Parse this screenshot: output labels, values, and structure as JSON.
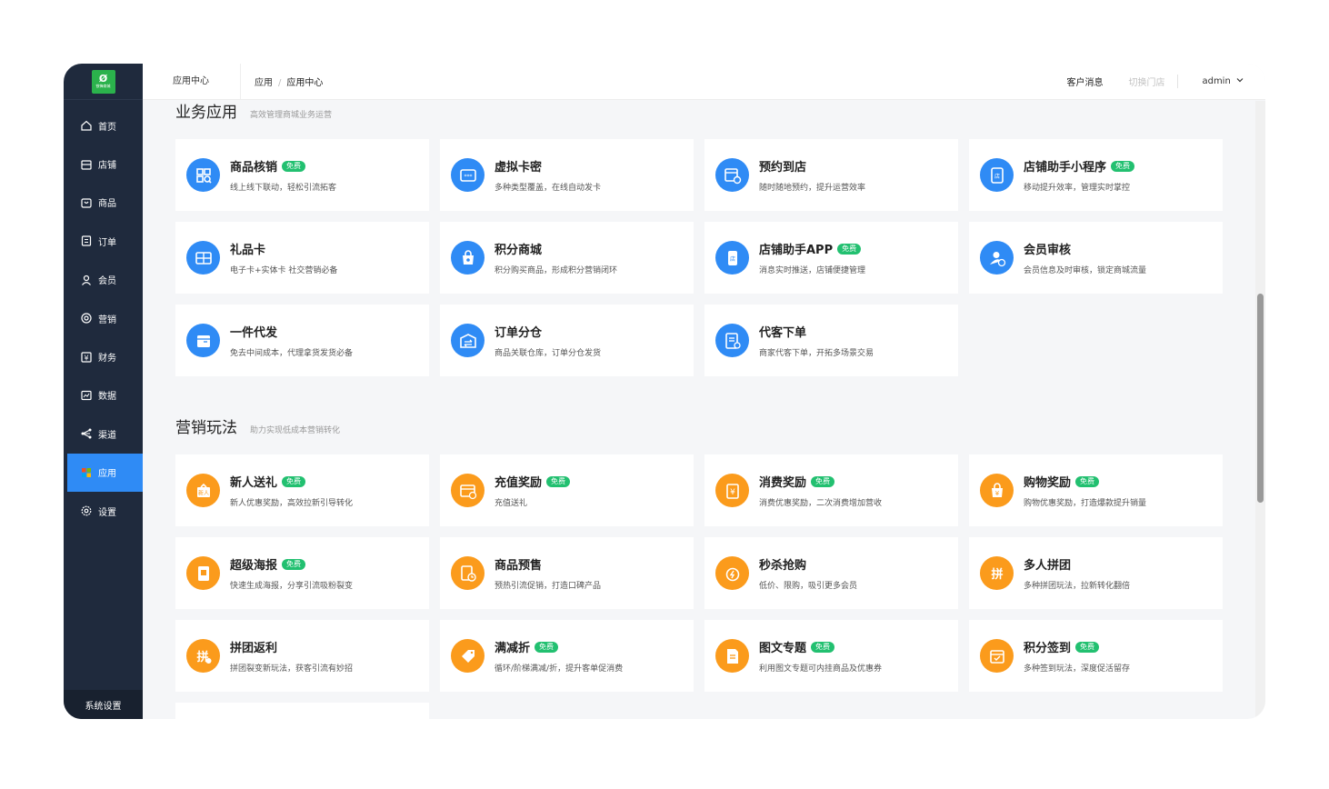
{
  "logo": {
    "glyph": "Ø",
    "text": "铁锋商城"
  },
  "sidebar": {
    "items": [
      {
        "label": "首页",
        "icon": "home-icon"
      },
      {
        "label": "店铺",
        "icon": "store-icon"
      },
      {
        "label": "商品",
        "icon": "goods-icon"
      },
      {
        "label": "订单",
        "icon": "order-icon"
      },
      {
        "label": "会员",
        "icon": "member-icon"
      },
      {
        "label": "营销",
        "icon": "marketing-icon"
      },
      {
        "label": "财务",
        "icon": "finance-icon"
      },
      {
        "label": "数据",
        "icon": "data-icon"
      },
      {
        "label": "渠道",
        "icon": "channel-icon"
      },
      {
        "label": "应用",
        "icon": "apps-icon",
        "active": true
      },
      {
        "label": "设置",
        "icon": "settings-icon"
      }
    ],
    "system_settings": "系统设置"
  },
  "header": {
    "title": "应用中心",
    "breadcrumb": [
      "应用",
      "应用中心"
    ],
    "messages": "客户消息",
    "switch_store": "切换门店",
    "user": "admin"
  },
  "sections": [
    {
      "title": "业务应用",
      "subtitle": "高效管理商城业务运营",
      "color": "blue",
      "cards": [
        {
          "name": "商品核销",
          "free": true,
          "desc": "线上线下联动，轻松引流拓客",
          "icon": "qr-scan-icon"
        },
        {
          "name": "虚拟卡密",
          "free": false,
          "desc": "多种类型覆盖，在线自动发卡",
          "icon": "virtual-card-icon"
        },
        {
          "name": "预约到店",
          "free": false,
          "desc": "随时随地预约，提升运营效率",
          "icon": "calendar-clock-icon"
        },
        {
          "name": "店铺助手小程序",
          "free": true,
          "desc": "移动提升效率，管理实时掌控",
          "icon": "mini-program-icon"
        },
        {
          "name": "礼品卡",
          "free": false,
          "desc": "电子卡+实体卡 社交营销必备",
          "icon": "gift-card-icon"
        },
        {
          "name": "积分商城",
          "free": false,
          "desc": "积分购买商品，形成积分营销闭环",
          "icon": "points-bag-icon"
        },
        {
          "name": "店铺助手APP",
          "free": true,
          "desc": "消息实时推送，店铺便捷管理",
          "icon": "phone-app-icon"
        },
        {
          "name": "会员审核",
          "free": false,
          "desc": "会员信息及时审核，锁定商城流量",
          "icon": "member-check-icon"
        },
        {
          "name": "一件代发",
          "free": false,
          "desc": "免去中间成本，代理拿货发货必备",
          "icon": "dropship-box-icon"
        },
        {
          "name": "订单分仓",
          "free": false,
          "desc": "商品关联仓库，订单分仓发货",
          "icon": "warehouse-icon"
        },
        {
          "name": "代客下单",
          "free": false,
          "desc": "商家代客下单，开拓多场景交易",
          "icon": "order-list-icon"
        }
      ]
    },
    {
      "title": "营销玩法",
      "subtitle": "助力实现低成本营销转化",
      "color": "orange",
      "cards": [
        {
          "name": "新人送礼",
          "free": true,
          "desc": "新人优惠奖励，高效拉新引导转化",
          "icon": "new-gift-icon"
        },
        {
          "name": "充值奖励",
          "free": true,
          "desc": "充值送礼",
          "icon": "recharge-icon"
        },
        {
          "name": "消费奖励",
          "free": true,
          "desc": "消费优惠奖励，二次消费增加营收",
          "icon": "consume-reward-icon"
        },
        {
          "name": "购物奖励",
          "free": true,
          "desc": "购物优惠奖励，打造爆款提升销量",
          "icon": "shopping-reward-icon"
        },
        {
          "name": "超级海报",
          "free": true,
          "desc": "快速生成海报，分享引流吸粉裂变",
          "icon": "poster-icon"
        },
        {
          "name": "商品预售",
          "free": false,
          "desc": "预热引流促销，打造口碑产品",
          "icon": "presale-icon"
        },
        {
          "name": "秒杀抢购",
          "free": false,
          "desc": "低价、限购，吸引更多会员",
          "icon": "flash-sale-icon"
        },
        {
          "name": "多人拼团",
          "free": false,
          "desc": "多种拼团玩法，拉新转化翻倍",
          "icon": "group-buy-icon"
        },
        {
          "name": "拼团返利",
          "free": false,
          "desc": "拼团裂变新玩法，获客引流有妙招",
          "icon": "group-rebate-icon"
        },
        {
          "name": "满减折",
          "free": true,
          "desc": "循环/阶梯满减/折，提升客单促消费",
          "icon": "discount-tag-icon"
        },
        {
          "name": "图文专题",
          "free": true,
          "desc": "利用图文专题可内挂商品及优惠券",
          "icon": "article-icon"
        },
        {
          "name": "积分签到",
          "free": true,
          "desc": "多种签到玩法，深度促活留存",
          "icon": "checkin-icon"
        }
      ]
    }
  ],
  "badge_label": "免费",
  "colors": {
    "sidebar": "#1f2a3d",
    "active": "#2f8bf5",
    "blue": "#2f8bf5",
    "orange": "#fb9b1c",
    "badge": "#22c070"
  }
}
